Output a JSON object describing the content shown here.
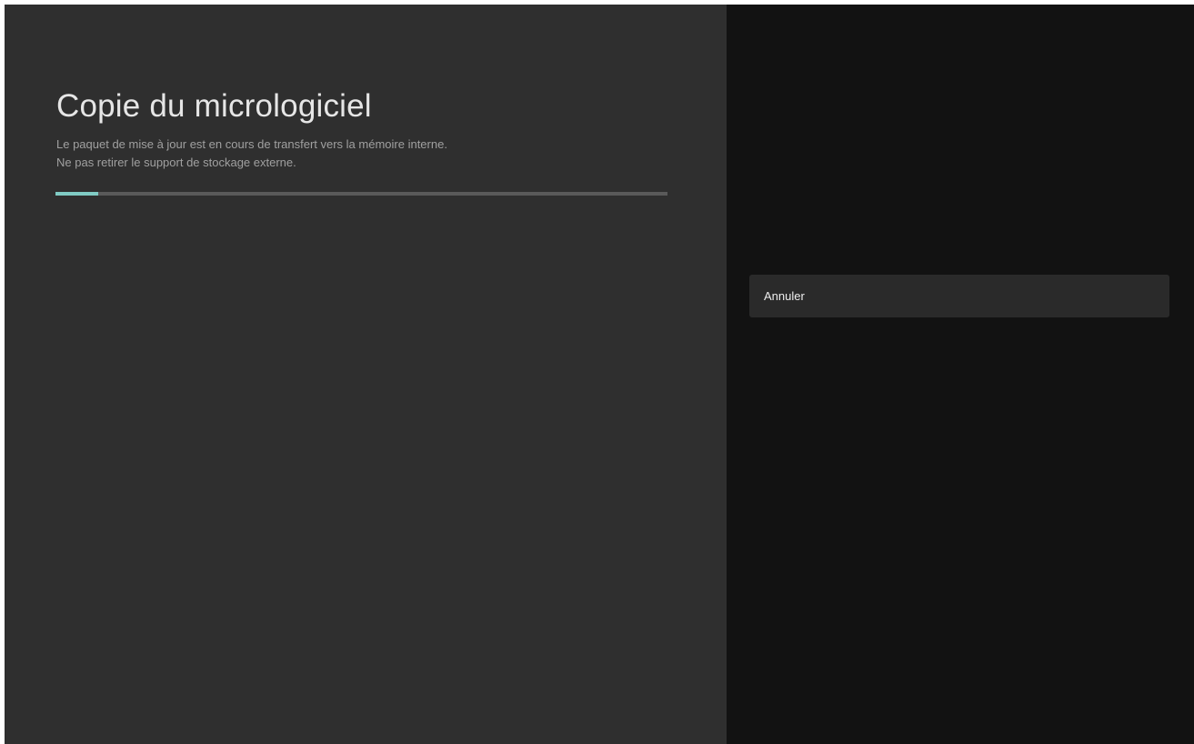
{
  "dialog": {
    "title": "Copie du micrologiciel",
    "description_line1": "Le paquet de mise à jour est en cours de transfert vers la mémoire interne.",
    "description_line2": "Ne pas retirer le support de stockage externe.",
    "progress": 0.07
  },
  "actions": {
    "cancel_label": "Annuler"
  },
  "colors": {
    "left_background": "#2f2f2f",
    "right_background": "#121212",
    "progress_fill": "#80cbc4",
    "progress_track": "#5a5a5a",
    "button_background": "#2a2a2a"
  }
}
